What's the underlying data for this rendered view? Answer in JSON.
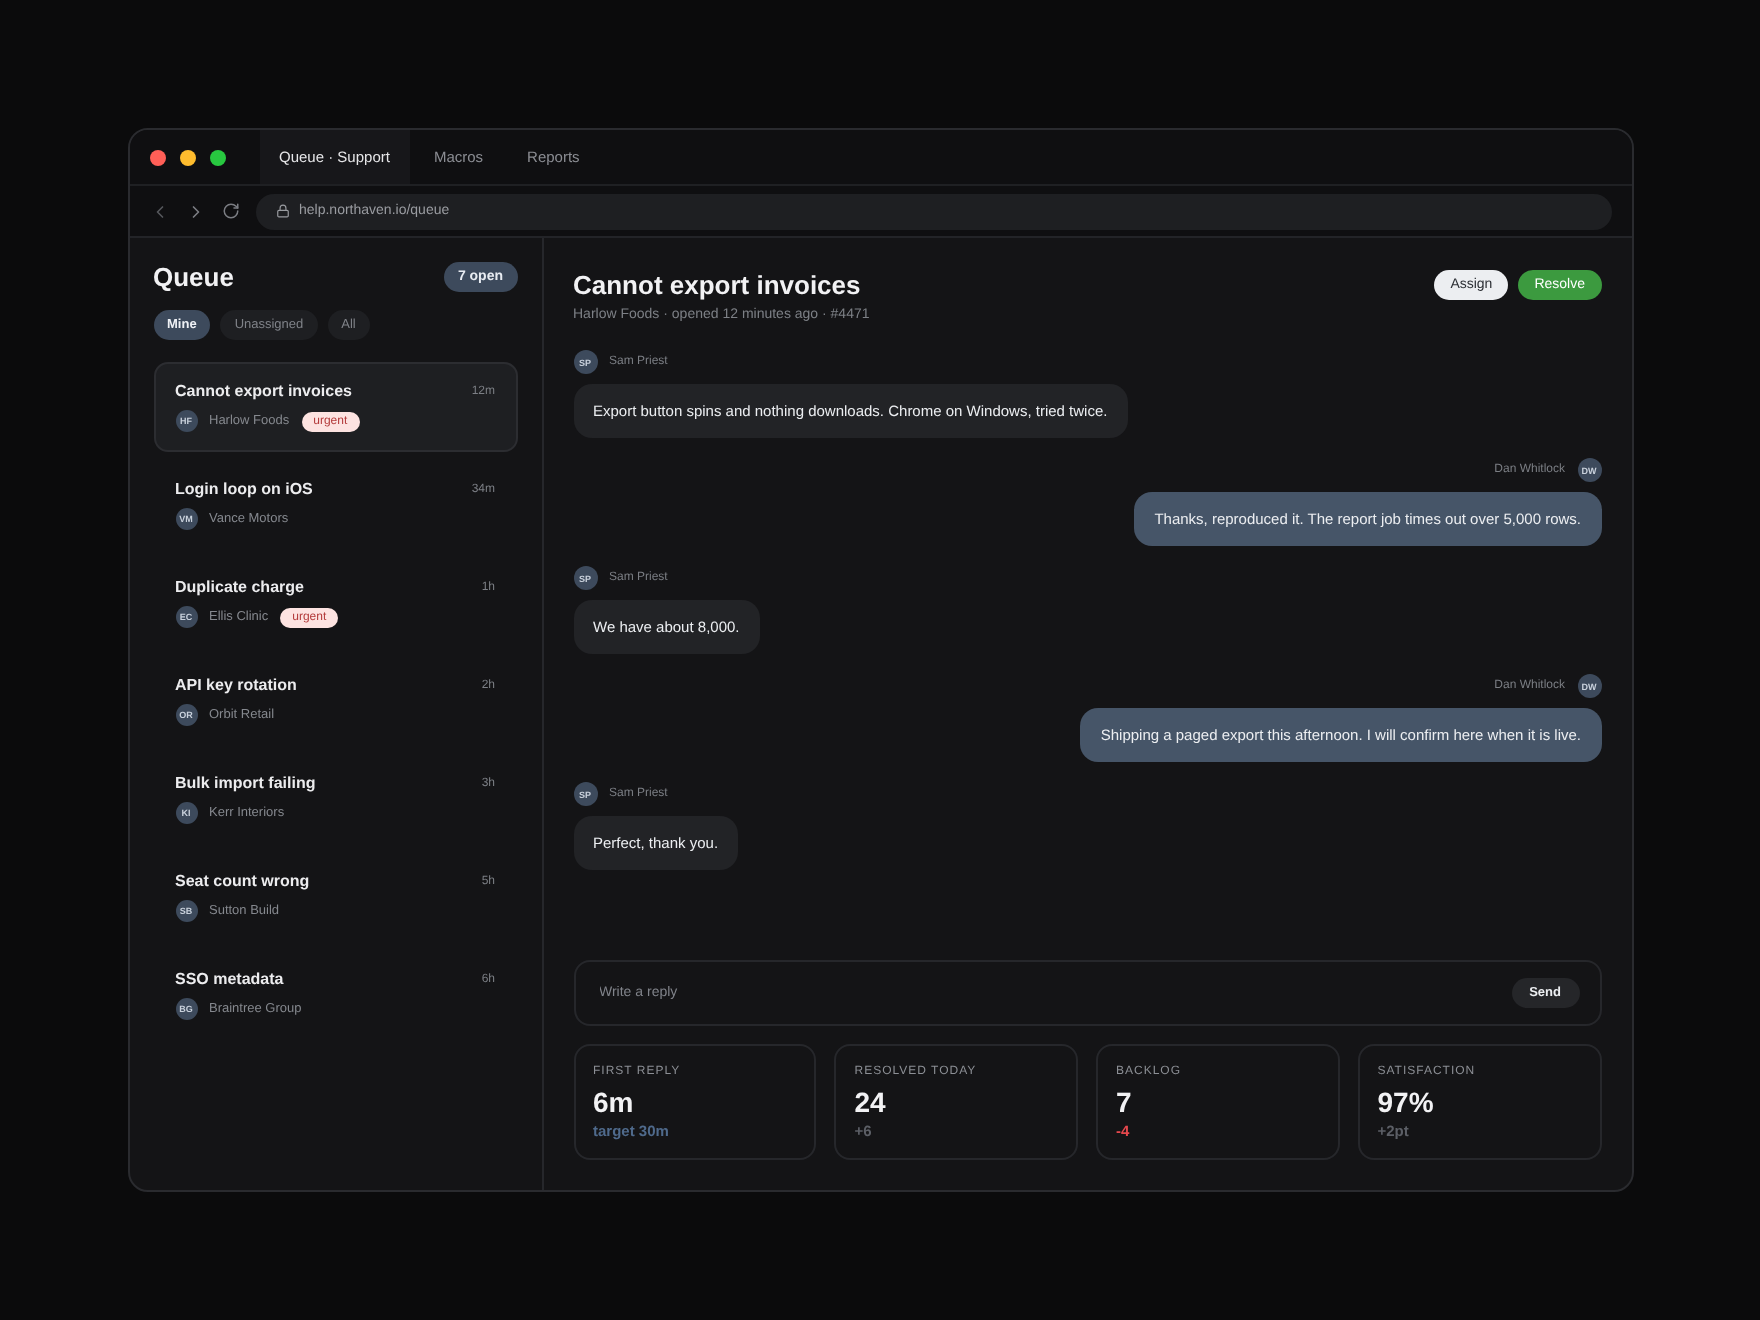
{
  "window": {
    "tabs": [
      {
        "label": "Queue · Support",
        "selected": true
      },
      {
        "label": "Macros",
        "selected": false
      },
      {
        "label": "Reports",
        "selected": false
      }
    ],
    "address": "help.northaven.io/queue"
  },
  "sidebar": {
    "title": "Queue",
    "count": "7 open",
    "filters": [
      {
        "label": "Mine",
        "selected": true
      },
      {
        "label": "Unassigned",
        "selected": false
      },
      {
        "label": "All",
        "selected": false
      }
    ],
    "tickets": [
      {
        "title": "Cannot export invoices",
        "time": "12m",
        "initials": "HF",
        "customer": "Harlow Foods",
        "tag": "urgent",
        "selected": true
      },
      {
        "title": "Login loop on iOS",
        "time": "34m",
        "initials": "VM",
        "customer": "Vance Motors",
        "selected": false
      },
      {
        "title": "Duplicate charge",
        "time": "1h",
        "initials": "EC",
        "customer": "Ellis Clinic",
        "tag": "urgent",
        "selected": false
      },
      {
        "title": "API key rotation",
        "time": "2h",
        "initials": "OR",
        "customer": "Orbit Retail",
        "selected": false
      },
      {
        "title": "Bulk import failing",
        "time": "3h",
        "initials": "KI",
        "customer": "Kerr Interiors",
        "selected": false
      },
      {
        "title": "Seat count wrong",
        "time": "5h",
        "initials": "SB",
        "customer": "Sutton Build",
        "selected": false
      },
      {
        "title": "SSO metadata",
        "time": "6h",
        "initials": "BG",
        "customer": "Braintree Group",
        "selected": false
      }
    ]
  },
  "conversation": {
    "title": "Cannot export invoices",
    "subtitle": "Harlow Foods · opened 12 minutes ago · #4471",
    "actions": [
      {
        "label": "Assign",
        "kind": "secondary"
      },
      {
        "label": "Resolve",
        "kind": "primary"
      }
    ],
    "messages": [
      {
        "kind": "incoming",
        "initials": "SP",
        "author": "Sam Priest",
        "text": "Export button spins and nothing downloads. Chrome on Windows, tried twice."
      },
      {
        "kind": "outgoing",
        "initials": "DW",
        "author": "Dan Whitlock",
        "text": "Thanks, reproduced it. The report job times out over 5,000 rows."
      },
      {
        "kind": "incoming",
        "initials": "SP",
        "author": "Sam Priest",
        "text": "We have about 8,000."
      },
      {
        "kind": "outgoing",
        "initials": "DW",
        "author": "Dan Whitlock",
        "text": "Shipping a paged export this afternoon. I will confirm here when it is live."
      },
      {
        "kind": "incoming",
        "initials": "SP",
        "author": "Sam Priest",
        "text": "Perfect, thank you."
      }
    ],
    "reply": {
      "placeholder": "Write a reply",
      "button": "Send"
    },
    "stats": [
      {
        "label": "FIRST REPLY",
        "value": "6m",
        "note": "target 30m",
        "color": "#4f6a8c"
      },
      {
        "label": "RESOLVED TODAY",
        "value": "24",
        "note": "+6",
        "color": "#5c5f66"
      },
      {
        "label": "BACKLOG",
        "value": "7",
        "note": "-4",
        "color": "#e5484d"
      },
      {
        "label": "SATISFACTION",
        "value": "97%",
        "note": "+2pt",
        "color": "#5c5f66"
      }
    ]
  }
}
